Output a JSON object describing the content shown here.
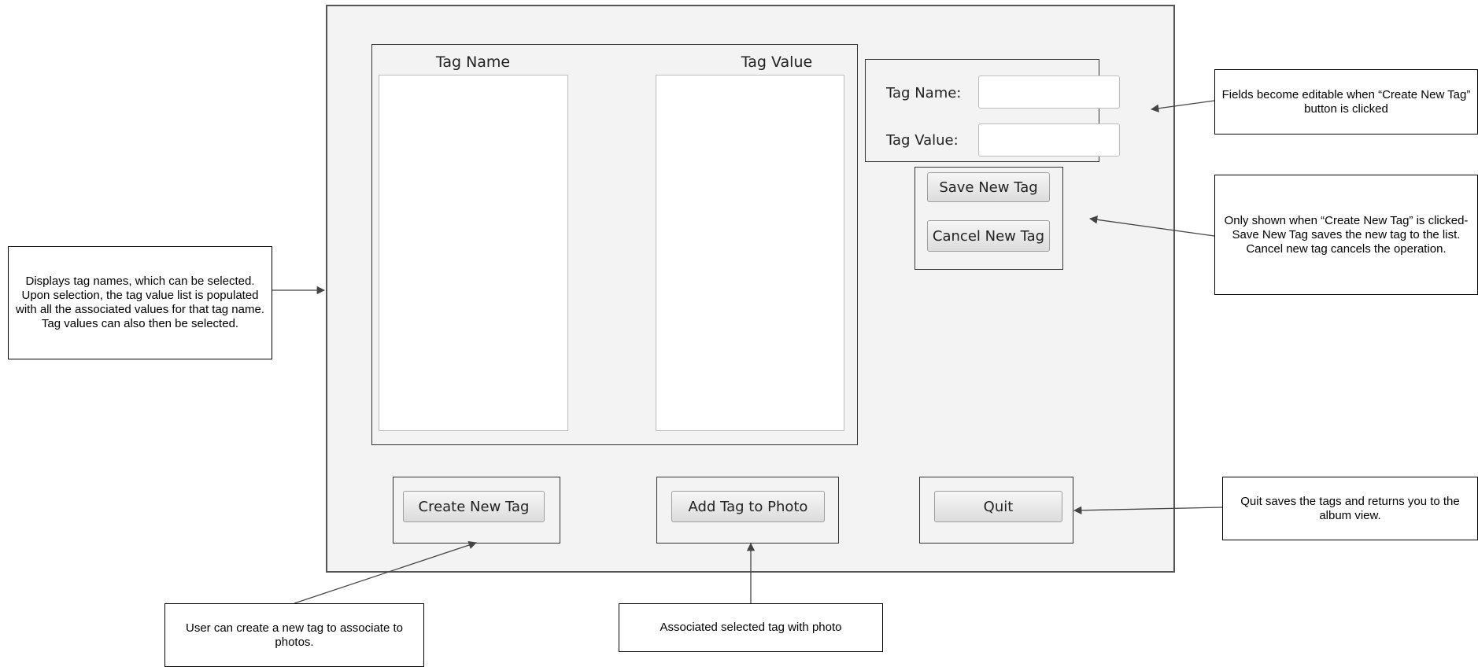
{
  "dialog": {
    "tag_name_list_header": "Tag Name",
    "tag_value_list_header": "Tag Value",
    "form": {
      "tag_name_label": "Tag Name:",
      "tag_value_label": "Tag Value:",
      "tag_name_value": "",
      "tag_value_value": ""
    },
    "buttons": {
      "save_new_tag": "Save New Tag",
      "cancel_new_tag": "Cancel New Tag",
      "create_new_tag": "Create New Tag",
      "add_tag_to_photo": "Add Tag to Photo",
      "quit": "Quit"
    }
  },
  "annotations": {
    "lists": "Displays tag names, which can be selected. Upon selection, the tag value list is populated with all the associated values for that tag name. Tag values can also then be selected.",
    "fields": "Fields become editable when “Create New Tag” button is clicked",
    "save_cancel": "Only shown when “Create New Tag” is clicked- Save New Tag saves the new tag to the list. Cancel new tag cancels the operation.",
    "quit": "Quit saves the tags and returns you to the album view.",
    "create": "User can create a new tag to associate to photos.",
    "add": "Associated selected tag with photo"
  },
  "colors": {
    "window_bg": "#f3f3f3",
    "window_border": "#555555",
    "annotation_arrow": "#444444"
  }
}
